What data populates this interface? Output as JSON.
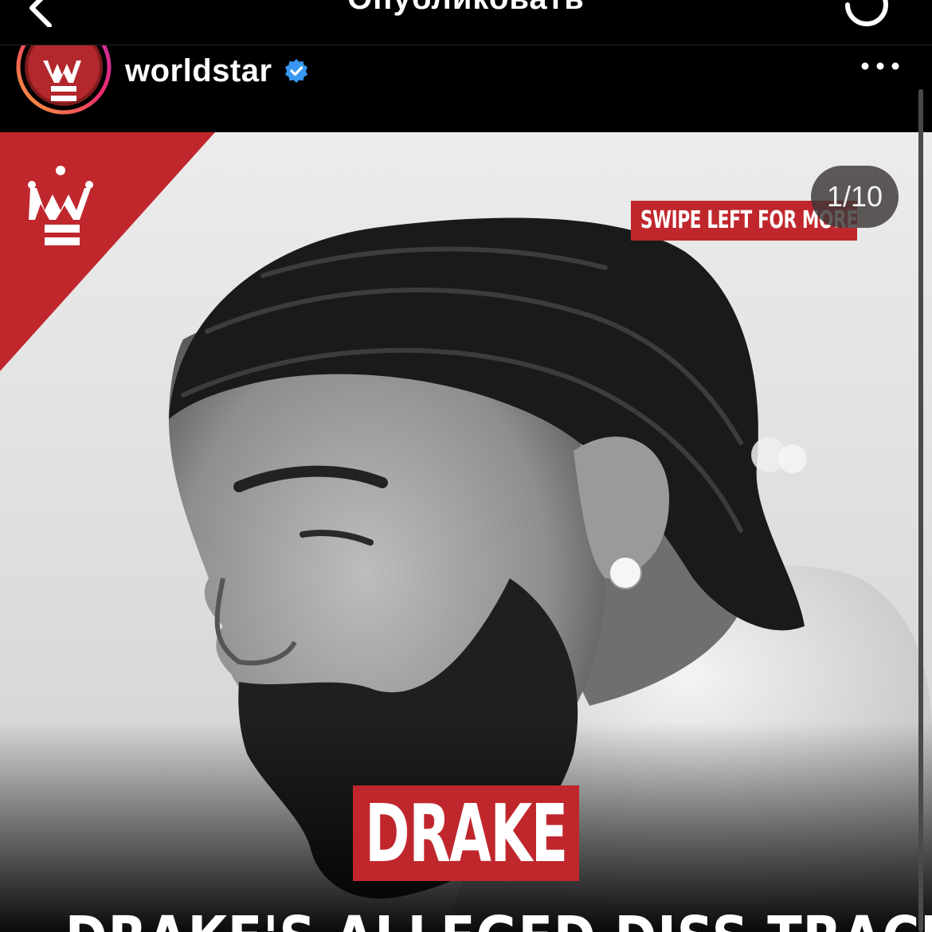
{
  "app": {
    "screen_title": "Опубликовать",
    "back_icon": "chevron-left-icon",
    "refresh_icon": "refresh-icon"
  },
  "post": {
    "username": "worldstar",
    "verified": true,
    "more_icon": "more-horizontal-icon",
    "avatar_icon": "worldstar-logo"
  },
  "media": {
    "counter": "1/10",
    "swipe_banner": "SWIPE LEFT FOR MORE",
    "subject_name": "DRAKE",
    "headline": "DRAKE'S ALLEGED DISS TRACK AGAINST",
    "brand_color": "#c0272d",
    "brand_logo": "worldstar-crown-logo"
  }
}
